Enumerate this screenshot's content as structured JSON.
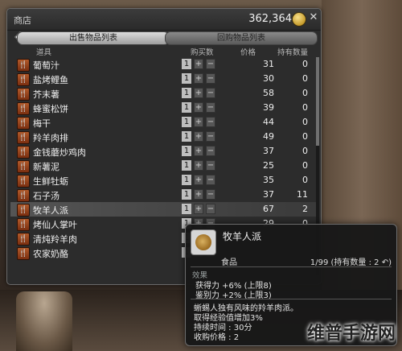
{
  "window": {
    "title": "商店",
    "gil": "362,364",
    "close_glyph": "✕"
  },
  "tabs": [
    {
      "label": "出售物品列表",
      "active": true
    },
    {
      "label": "回购物品列表",
      "active": false
    }
  ],
  "columns": {
    "item": "道具",
    "buy_qty": "购买数",
    "price": "价格",
    "owned": "持有数量"
  },
  "items": [
    {
      "name": "葡萄汁",
      "qty": "1",
      "price": "31",
      "owned": "0"
    },
    {
      "name": "盐烤鲤鱼",
      "qty": "1",
      "price": "30",
      "owned": "0"
    },
    {
      "name": "芥末薯",
      "qty": "1",
      "price": "58",
      "owned": "0"
    },
    {
      "name": "蜂蜜松饼",
      "qty": "1",
      "price": "39",
      "owned": "0"
    },
    {
      "name": "梅干",
      "qty": "1",
      "price": "44",
      "owned": "0"
    },
    {
      "name": "羚羊肉排",
      "qty": "1",
      "price": "49",
      "owned": "0"
    },
    {
      "name": "金钱蘑炒鸡肉",
      "qty": "1",
      "price": "37",
      "owned": "0"
    },
    {
      "name": "新薯泥",
      "qty": "1",
      "price": "25",
      "owned": "0"
    },
    {
      "name": "生鲜牡蛎",
      "qty": "1",
      "price": "35",
      "owned": "0"
    },
    {
      "name": "石子汤",
      "qty": "1",
      "price": "37",
      "owned": "11"
    },
    {
      "name": "牧羊人派",
      "qty": "1",
      "price": "67",
      "owned": "2",
      "selected": true
    },
    {
      "name": "烤仙人掌叶",
      "qty": "1",
      "price": "29",
      "owned": "0"
    },
    {
      "name": "清炖羚羊肉",
      "qty": "1",
      "price": "",
      "owned": ""
    },
    {
      "name": "农家奶酪",
      "qty": "1",
      "price": "",
      "owned": ""
    }
  ],
  "tooltip": {
    "name": "牧羊人派",
    "category": "食品",
    "stack": "1/99 (持有数量 : 2",
    "stack_suffix": ")",
    "effect_label": "效果",
    "effects": [
      "获得力 +6% (上限8)",
      "鉴别力 +2% (上限3)"
    ],
    "desc": [
      "蜥蜴人独有风味的羚羊肉派。",
      "取得经验值增加3%",
      "持续时间 : 30分"
    ],
    "sell": "收购价格 : 2"
  },
  "watermark": "维普手游网",
  "colors": {
    "panel": "#2c2c2c",
    "tab_active": "#dcdcdc",
    "food_icon": "#b25a2a"
  }
}
